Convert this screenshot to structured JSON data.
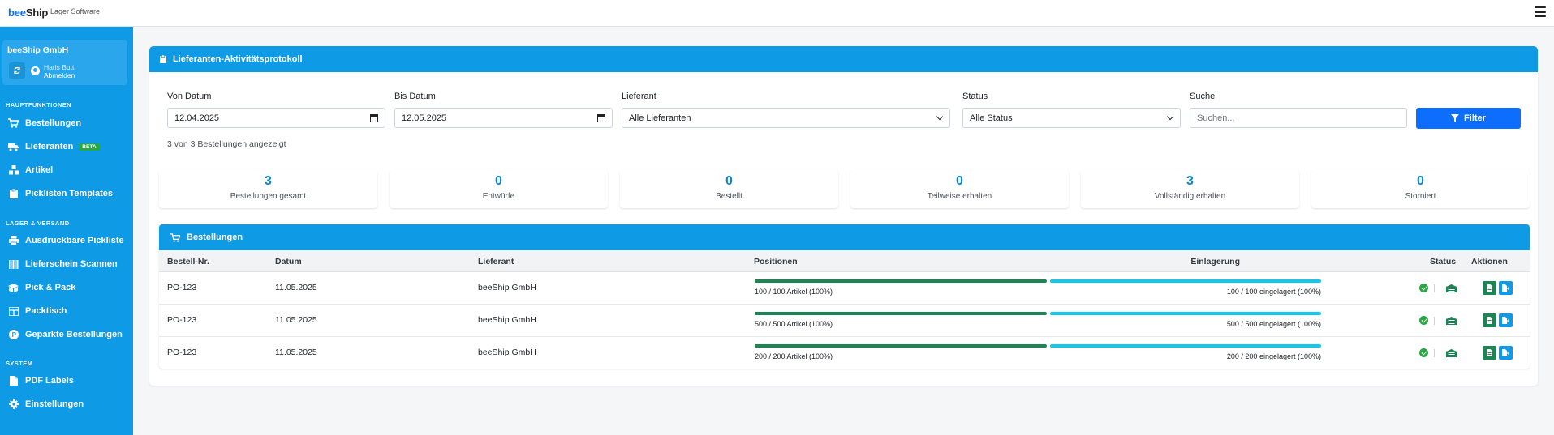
{
  "app": {
    "brand_bold": "beeShip",
    "brand_sub": "Lager Software",
    "menu_icon": "hamburger-icon"
  },
  "sidebar": {
    "company": "beeShip GmbH",
    "user_name": "Haris Butt",
    "logout_label": "Abmelden",
    "sections": {
      "main": "HAUPTFUNKTIONEN",
      "warehouse": "LAGER & VERSAND",
      "system": "SYSTEM"
    },
    "items": [
      {
        "label": "Bestellungen",
        "icon": "cart-icon"
      },
      {
        "label": "Lieferanten",
        "icon": "truck-icon",
        "badge": "BETA"
      },
      {
        "label": "Artikel",
        "icon": "boxes-icon"
      },
      {
        "label": "Picklisten Templates",
        "icon": "clipboard-icon"
      },
      {
        "label": "Ausdruckbare Pickliste",
        "icon": "printer-icon"
      },
      {
        "label": "Lieferschein Scannen",
        "icon": "barcode-icon"
      },
      {
        "label": "Pick & Pack",
        "icon": "box-icon"
      },
      {
        "label": "Packtisch",
        "icon": "table-icon"
      },
      {
        "label": "Geparkte Bestellungen",
        "icon": "parking-icon"
      },
      {
        "label": "PDF Labels",
        "icon": "pdf-icon"
      },
      {
        "label": "Einstellungen",
        "icon": "gear-icon"
      }
    ]
  },
  "panel": {
    "title": "Lieferanten-Aktivitätsprotokoll"
  },
  "filters": {
    "from_label": "Von Datum",
    "from_value": "12.04.2025",
    "to_label": "Bis Datum",
    "to_value": "12.05.2025",
    "supplier_label": "Lieferant",
    "supplier_value": "Alle Lieferanten",
    "status_label": "Status",
    "status_value": "Alle Status",
    "search_label": "Suche",
    "search_placeholder": "Suchen...",
    "filter_button": "Filter"
  },
  "count_text": "3 von 3 Bestellungen angezeigt",
  "stats": [
    {
      "value": "3",
      "label": "Bestellungen gesamt"
    },
    {
      "value": "0",
      "label": "Entwürfe"
    },
    {
      "value": "0",
      "label": "Bestellt"
    },
    {
      "value": "0",
      "label": "Teilweise erhalten"
    },
    {
      "value": "3",
      "label": "Vollständig erhalten"
    },
    {
      "value": "0",
      "label": "Storniert"
    }
  ],
  "orders": {
    "title": "Bestellungen",
    "columns": {
      "order_no": "Bestell-Nr.",
      "date": "Datum",
      "supplier": "Lieferant",
      "positions": "Positionen",
      "storage": "Einlagerung",
      "status": "Status",
      "actions": "Aktionen"
    },
    "rows": [
      {
        "order_no": "PO-123",
        "date": "11.05.2025",
        "supplier": "beeShip GmbH",
        "positions_text": "100 / 100 Artikel (100%)",
        "storage_text": "100 / 100 eingelagert (100%)",
        "positions_pct": 1.0,
        "storage_pct": 1.0
      },
      {
        "order_no": "PO-123",
        "date": "11.05.2025",
        "supplier": "beeShip GmbH",
        "positions_text": "500 / 500 Artikel (100%)",
        "storage_text": "500 / 500 eingelagert (100%)",
        "positions_pct": 1.0,
        "storage_pct": 1.0
      },
      {
        "order_no": "PO-123",
        "date": "11.05.2025",
        "supplier": "beeShip GmbH",
        "positions_text": "200 / 200 Artikel (100%)",
        "storage_text": "200 / 200 eingelagert (100%)",
        "positions_pct": 1.0,
        "storage_pct": 1.0
      }
    ]
  },
  "colors": {
    "sidebar": "#0f9ae6",
    "primary": "#0d6efd",
    "success": "#198754",
    "info": "#0dcaf0"
  }
}
